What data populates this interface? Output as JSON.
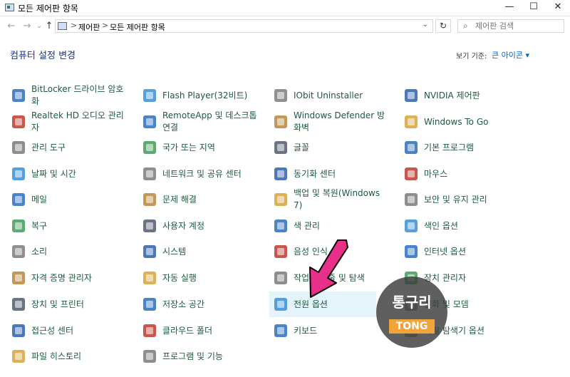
{
  "window": {
    "title": "모든 제어판 항목",
    "min": "—",
    "max": "☐",
    "close": "✕"
  },
  "nav": {
    "back": "←",
    "forward": "→",
    "dropdown": "⌄",
    "up": "↑"
  },
  "address": {
    "crumbs": [
      "제어판",
      "모든 제어판 항목"
    ],
    "separators": [
      ">",
      ">"
    ],
    "dropdown": "⌄",
    "refresh": "↻"
  },
  "search": {
    "placeholder": "제어판 검색"
  },
  "header": {
    "title": "컴퓨터 설정 변경",
    "view_by_label": "보기 기준:",
    "view_by_value": "큰 아이콘 ▾"
  },
  "columns": [
    [
      "BitLocker 드라이브 암호화",
      "Realtek HD 오디오 관리자",
      "관리 도구",
      "날짜 및 시간",
      "메일",
      "복구",
      "소리",
      "자격 증명 관리자",
      "장치 및 프린터",
      "접근성 센터",
      "파일 히스토리"
    ],
    [
      "Flash Player(32비트)",
      "RemoteApp 및 데스크톱 연결",
      "국가 또는 지역",
      "네트워크 및 공유 센터",
      "문제 해결",
      "사용자 계정",
      "시스템",
      "자동 실행",
      "저장소 공간",
      "클라우드 폴더",
      "프로그램 및 기능"
    ],
    [
      "IObit Uninstaller",
      "Windows Defender 방화벽",
      "글꼴",
      "동기화 센터",
      "백업 및 복원(Windows 7)",
      "색 관리",
      "음성 인식",
      "작업 표시줄 및 탐색",
      "전원 옵션",
      "키보드"
    ],
    [
      "NVIDIA 제어판",
      "Windows To Go",
      "기본 프로그램",
      "마우스",
      "보안 및 유지 관리",
      "색인 옵션",
      "인터넷 옵션",
      "장치 관리자",
      "전화 및 모뎀",
      "파일 탐색기 옵션"
    ]
  ],
  "icons": [
    [
      "bitlocker-icon",
      "realtek-icon",
      "admin-tools-icon",
      "date-time-icon",
      "mail-icon",
      "recovery-icon",
      "sound-icon",
      "credential-icon",
      "devices-printers-icon",
      "ease-access-icon",
      "file-history-icon"
    ],
    [
      "flash-icon",
      "remoteapp-icon",
      "region-icon",
      "network-icon",
      "troubleshoot-icon",
      "user-accounts-icon",
      "system-icon",
      "autoplay-icon",
      "storage-spaces-icon",
      "cloud-folder-icon",
      "programs-icon"
    ],
    [
      "iobit-icon",
      "firewall-icon",
      "fonts-icon",
      "sync-icon",
      "backup-icon",
      "color-mgmt-icon",
      "speech-icon",
      "taskbar-icon",
      "power-icon",
      "keyboard-icon"
    ],
    [
      "nvidia-icon",
      "windows-to-go-icon",
      "default-programs-icon",
      "mouse-icon",
      "security-maintenance-icon",
      "indexing-icon",
      "internet-options-icon",
      "device-manager-icon",
      "phone-modem-icon",
      "explorer-options-icon"
    ]
  ],
  "badge": {
    "line1": "통구리",
    "line2": "TONG"
  },
  "colors": {
    "link": "#1e5a3c",
    "title": "#1e3287",
    "accent": "#0066cc",
    "highlight": "#e5f3fb",
    "arrow": "#e8308a"
  }
}
